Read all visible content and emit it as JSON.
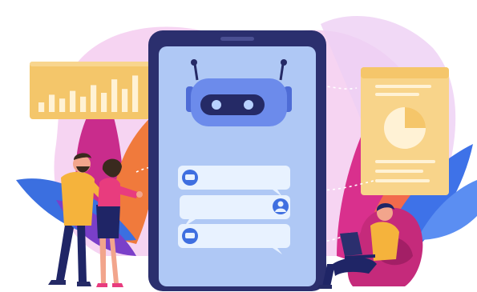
{
  "illustration": {
    "subject": "chatbot-on-tablet",
    "colors": {
      "blob_pink": "#F3C6EE",
      "leaf_magenta": "#E0338F",
      "leaf_orange": "#F07A3C",
      "leaf_blue": "#3B6FE0",
      "tablet_frame": "#2B2F6E",
      "tablet_screen": "#AFC8F5",
      "robot_head": "#6C8BEB",
      "robot_visor": "#252A66",
      "robot_eyes": "#B8D1FF",
      "chart_card": "#F4C66A",
      "chart_bars": "#FFF2D5",
      "doc_card": "#F8D48A",
      "chat_bubble": "#E8F2FF",
      "chat_icon": "#3F6FE0",
      "person_shirt_yellow": "#F5B33C",
      "person_pants": "#1F2566",
      "woman_top": "#E83C7E",
      "beanbag": "#C52A7B"
    },
    "chart": {
      "type": "bar",
      "values": [
        0.25,
        0.45,
        0.35,
        0.55,
        0.4,
        0.7,
        0.5,
        0.85,
        0.6,
        0.95
      ]
    },
    "chat_messages": [
      {
        "side": "bot",
        "icon": "chat-icon"
      },
      {
        "side": "user",
        "icon": "user-icon"
      },
      {
        "side": "bot",
        "icon": "chat-icon"
      }
    ]
  }
}
